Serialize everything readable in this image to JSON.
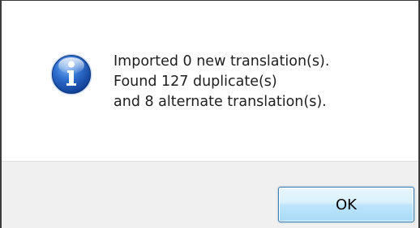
{
  "dialog": {
    "icon": "information-icon",
    "message_lines": [
      "Imported 0 new translation(s).",
      "Found 127 duplicate(s)",
      "and 8 alternate translation(s)."
    ],
    "ok_label": "OK"
  },
  "colors": {
    "icon_blue": "#1f5fb8",
    "button_border": "#3c7fb1",
    "footer_bg": "#f0f0f0"
  }
}
